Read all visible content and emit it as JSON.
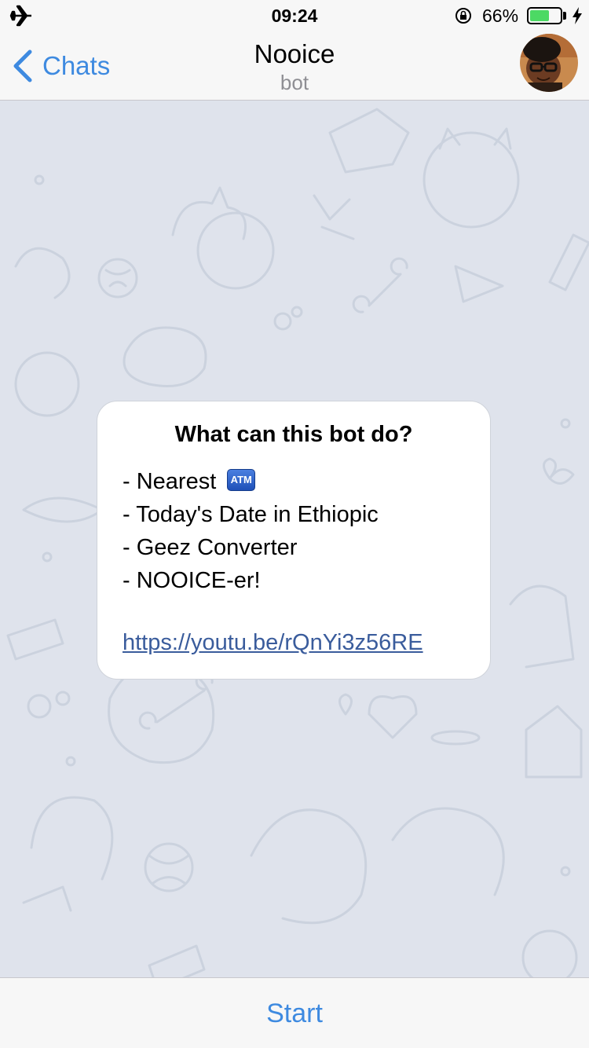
{
  "status_bar": {
    "time": "09:24",
    "battery_percent": "66%",
    "battery_level": 0.66,
    "icons": [
      "airplane-icon",
      "rotation-lock-icon",
      "battery-icon",
      "charging-bolt-icon"
    ]
  },
  "nav": {
    "back_label": "Chats",
    "title": "Nooice",
    "subtitle": "bot"
  },
  "card": {
    "title": "What can this bot do?",
    "lines": [
      "- Nearest",
      "- Today's Date in Ethiopic",
      "- Geez Converter",
      "- NOOICE-er!"
    ],
    "atm_label": "ATM",
    "link": "https://youtu.be/rQnYi3z56RE"
  },
  "bottom": {
    "start_label": "Start"
  },
  "colors": {
    "accent": "#3e8ae0",
    "chat_background": "#dfe3ec",
    "bar_background": "#f7f7f7",
    "battery_green": "#4cd964",
    "link": "#3a5c9c"
  }
}
